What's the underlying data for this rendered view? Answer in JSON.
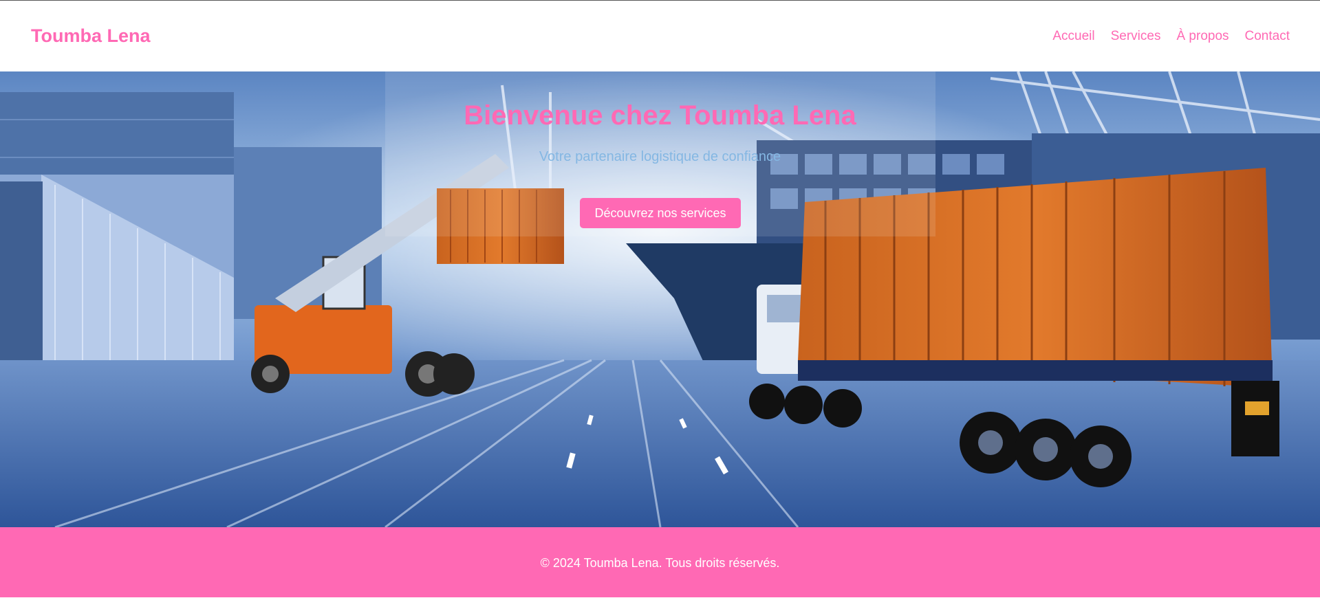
{
  "header": {
    "brand": "Toumba Lena",
    "nav": [
      {
        "label": "Accueil"
      },
      {
        "label": "Services"
      },
      {
        "label": "À propos"
      },
      {
        "label": "Contact"
      }
    ]
  },
  "hero": {
    "title": "Bienvenue chez Toumba Lena",
    "subtitle": "Votre partenaire logistique de confiance",
    "cta_label": "Découvrez nos services"
  },
  "footer": {
    "text": "© 2024 Toumba Lena. Tous droits réservés."
  },
  "colors": {
    "accent": "#ff69b4",
    "header_bg": "#ffffff",
    "footer_text": "#ffffff"
  },
  "icons": [
    "container-port-photo"
  ]
}
